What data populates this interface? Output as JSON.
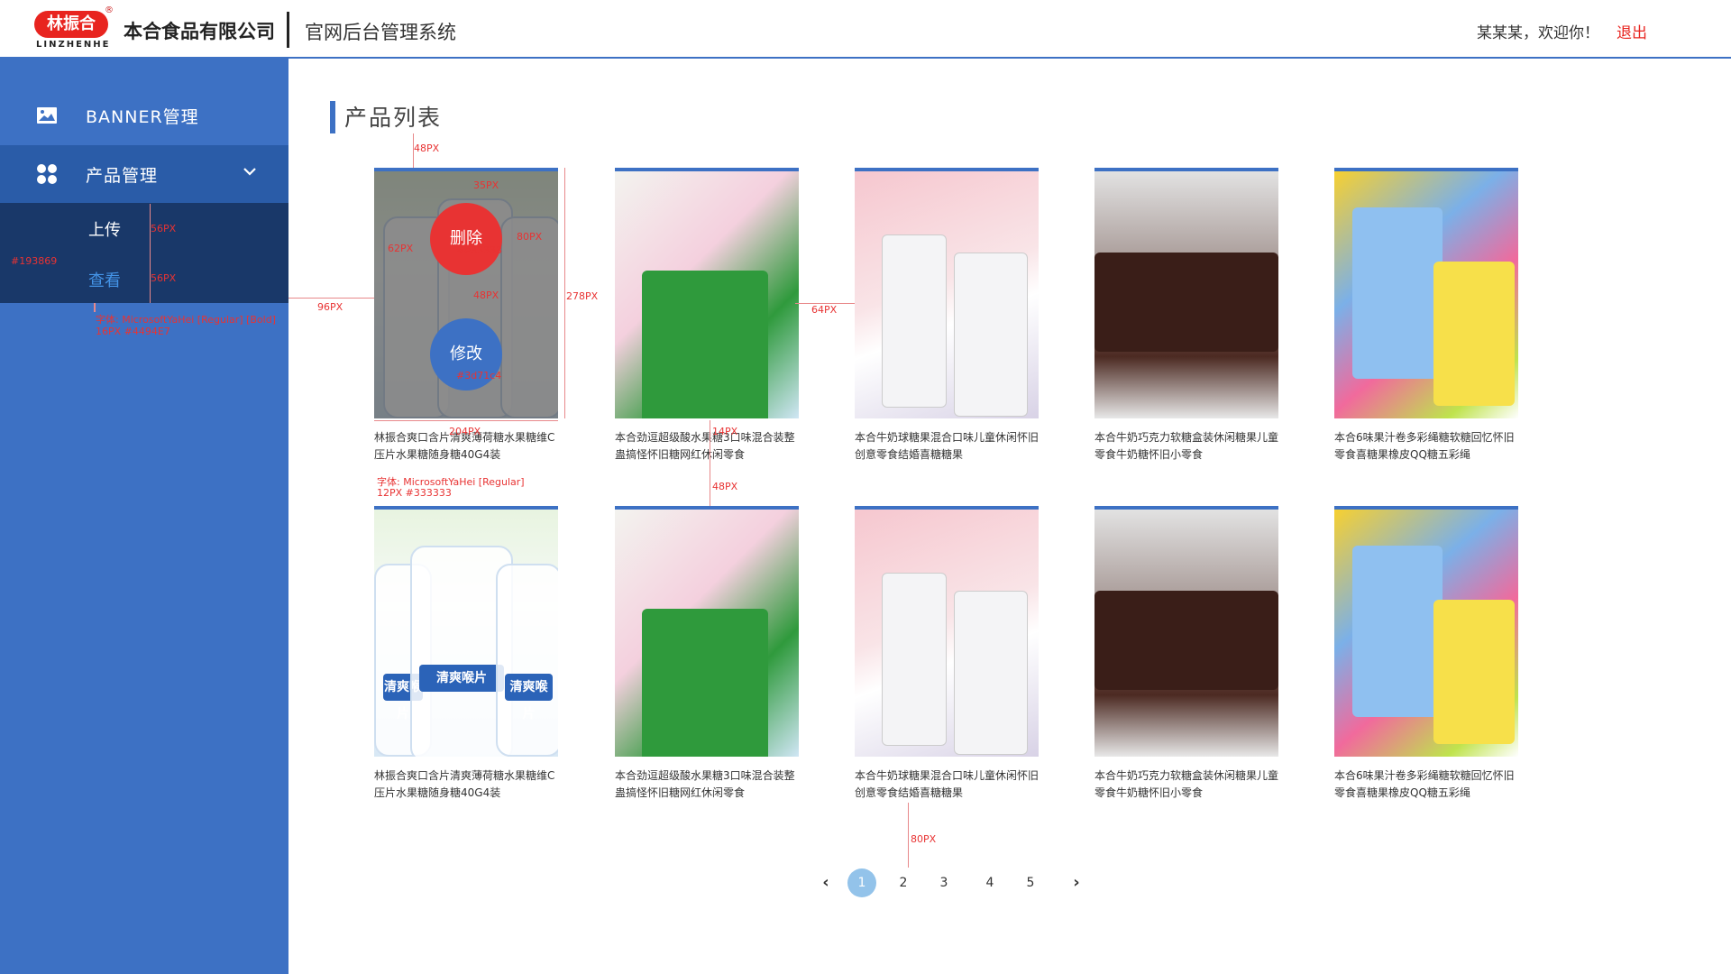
{
  "header": {
    "logo_text": "林振合",
    "logo_sub": "LINZHENHE",
    "logo_reg": "®",
    "company": "本合食品有限公司",
    "system_name": "官网后台管理系统",
    "welcome": "某某某，欢迎你！",
    "logout": "退出"
  },
  "sidebar": {
    "items": [
      {
        "label": "BANNER管理",
        "icon": "image-icon"
      },
      {
        "label": "产品管理",
        "icon": "grid-icon",
        "chevron": "chevron-down-icon"
      }
    ],
    "submenu": [
      {
        "label": "上传"
      },
      {
        "label": "查看",
        "active": true
      }
    ]
  },
  "main": {
    "title": "产品列表",
    "overlay": {
      "delete": "删除",
      "edit": "修改"
    },
    "products": [
      {
        "name": "林振合爽口含片清爽薄荷糖水果糖维C压片水果糖随身糖40G4装",
        "image": "mints"
      },
      {
        "name": "本合劲逗超级酸水果糖3口味混合装整蛊搞怪怀旧糖网红休闲零食",
        "image": "sour"
      },
      {
        "name": "本合牛奶球糖果混合口味儿童休闲怀旧创意零食结婚喜糖糖果",
        "image": "milk"
      },
      {
        "name": "本合牛奶巧克力软糖盒装休闲糖果儿童零食牛奶糖怀旧小零食",
        "image": "choc"
      },
      {
        "name": "本合6味果汁卷多彩绳糖软糖回忆怀旧零食喜糖果橡皮QQ糖五彩绳",
        "image": "colorful"
      },
      {
        "name": "林振合爽口含片清爽薄荷糖水果糖维C压片水果糖随身糖40G4装",
        "image": "mints"
      },
      {
        "name": "本合劲逗超级酸水果糖3口味混合装整蛊搞怪怀旧糖网红休闲零食",
        "image": "sour"
      },
      {
        "name": "本合牛奶球糖果混合口味儿童休闲怀旧创意零食结婚喜糖糖果",
        "image": "milk"
      },
      {
        "name": "本合牛奶巧克力软糖盒装休闲糖果儿童零食牛奶糖怀旧小零食",
        "image": "choc"
      },
      {
        "name": "本合6味果汁卷多彩绳糖软糖回忆怀旧零食喜糖果橡皮QQ糖五彩绳",
        "image": "colorful"
      }
    ],
    "jar_label": "清爽喉片"
  },
  "pagination": {
    "prev": "‹",
    "pages": [
      "1",
      "2",
      "3",
      "4",
      "5"
    ],
    "active": "1",
    "next": "›"
  },
  "annotations": {
    "sidebar_color": "#193869",
    "sidebar_font": "字体: MicrosoftYaHei [Regular] [Bold]",
    "sidebar_font2": "16PX #4494E7",
    "card_font": "字体: MicrosoftYaHei [Regular]",
    "card_font2": "12PX #333333",
    "delete_color": "#e83333",
    "edit_color": "#3d71c4",
    "px_48a": "48PX",
    "px_35": "35PX",
    "px_62": "62PX",
    "px_80": "80PX",
    "px_48b": "48PX",
    "px_278": "278PX",
    "px_204": "204PX",
    "px_96": "96PX",
    "px_64": "64PX",
    "px_14": "14PX",
    "px_48c": "48PX",
    "px_56a": "56PX",
    "px_56b": "56PX",
    "px_80b": "80PX"
  },
  "colors": {
    "primary": "#3d71c4",
    "submenu_bg": "#193869",
    "active_text": "#4494e7",
    "danger": "#e83333"
  }
}
